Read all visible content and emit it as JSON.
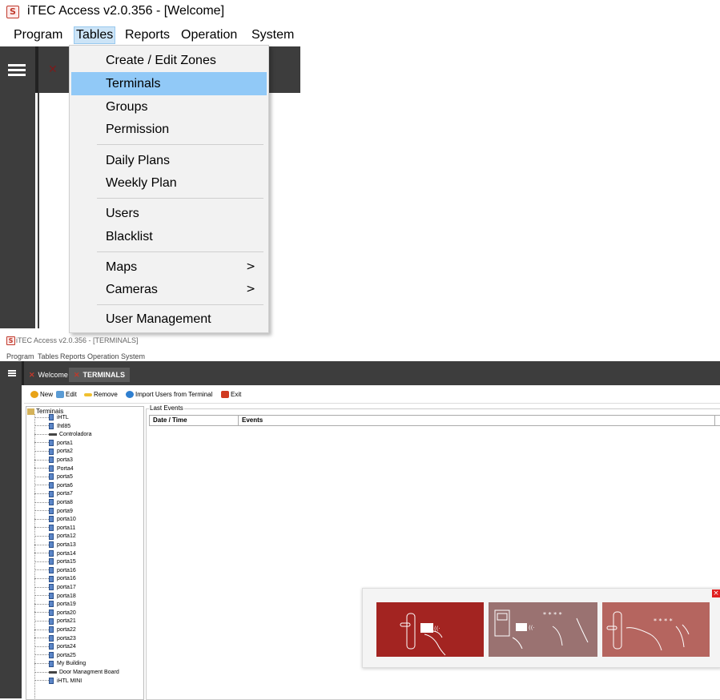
{
  "window1": {
    "logo": "S",
    "title": "iTEC Access v2.0.356 - [Welcome]",
    "menus": [
      "Program",
      "Tables",
      "Reports",
      "Operation",
      "System"
    ],
    "active_menu": "Tables",
    "dropdown": {
      "groups": [
        [
          {
            "label": "Create / Edit Zones"
          },
          {
            "label": "Terminals",
            "highlighted": true
          },
          {
            "label": "Groups"
          },
          {
            "label": "Permission"
          }
        ],
        [
          {
            "label": "Daily Plans"
          },
          {
            "label": "Weekly Plan"
          }
        ],
        [
          {
            "label": "Users"
          },
          {
            "label": "Blacklist"
          }
        ],
        [
          {
            "label": "Maps",
            "submenu": true
          },
          {
            "label": "Cameras",
            "submenu": true
          }
        ],
        [
          {
            "label": "User Management"
          }
        ]
      ],
      "submenu_arrow": ">"
    }
  },
  "window2": {
    "logo": "S",
    "title": "iTEC Access v2.0.356 - [TERMINALS]",
    "menus": [
      "Program",
      "Tables",
      "Reports",
      "Operation",
      "System"
    ],
    "tabs": [
      {
        "label": "Welcome",
        "active": false
      },
      {
        "label": "TERMINALS",
        "active": true
      }
    ],
    "toolbar": [
      {
        "label": "New",
        "icon": "new-icon",
        "color": "#e8a317"
      },
      {
        "label": "Edit",
        "icon": "edit-icon",
        "color": "#5a9bd4"
      },
      {
        "label": "Remove",
        "icon": "remove-icon",
        "color": "#f0c030"
      },
      {
        "label": "Import Users from Terminal",
        "icon": "import-icon",
        "color": "#2f7fd0"
      },
      {
        "label": "Exit",
        "icon": "exit-icon",
        "color": "#d03a20"
      }
    ],
    "tree": {
      "root": "Terminais",
      "items": [
        {
          "label": "iHTL",
          "type": "terminal"
        },
        {
          "label": "Ihtl85",
          "type": "terminal"
        },
        {
          "label": "Controladora",
          "type": "controller"
        },
        {
          "label": "porta1",
          "type": "terminal"
        },
        {
          "label": "porta2",
          "type": "terminal"
        },
        {
          "label": "porta3",
          "type": "terminal"
        },
        {
          "label": "Porta4",
          "type": "terminal"
        },
        {
          "label": "porta5",
          "type": "terminal"
        },
        {
          "label": "porta6",
          "type": "terminal"
        },
        {
          "label": "porta7",
          "type": "terminal"
        },
        {
          "label": "porta8",
          "type": "terminal"
        },
        {
          "label": "porta9",
          "type": "terminal"
        },
        {
          "label": "porta10",
          "type": "terminal"
        },
        {
          "label": "porta11",
          "type": "terminal"
        },
        {
          "label": "porta12",
          "type": "terminal"
        },
        {
          "label": "porta13",
          "type": "terminal"
        },
        {
          "label": "porta14",
          "type": "terminal"
        },
        {
          "label": "porta15",
          "type": "terminal"
        },
        {
          "label": "porta16",
          "type": "terminal"
        },
        {
          "label": "porta16",
          "type": "terminal"
        },
        {
          "label": "porta17",
          "type": "terminal"
        },
        {
          "label": "porta18",
          "type": "terminal"
        },
        {
          "label": "porta19",
          "type": "terminal"
        },
        {
          "label": "porta20",
          "type": "terminal"
        },
        {
          "label": "porta21",
          "type": "terminal"
        },
        {
          "label": "porta22",
          "type": "terminal"
        },
        {
          "label": "porta23",
          "type": "terminal"
        },
        {
          "label": "porta24",
          "type": "terminal"
        },
        {
          "label": "porta25",
          "type": "terminal"
        },
        {
          "label": "My Building",
          "type": "terminal"
        },
        {
          "label": "Door Managment Board",
          "type": "controller"
        },
        {
          "label": "iHTL MINI",
          "type": "terminal"
        }
      ]
    },
    "events": {
      "legend": "Last Events",
      "columns": [
        "Date / Time",
        "Events"
      ]
    }
  },
  "popup": {
    "close": "×",
    "colors": [
      "#a32421",
      "#9a7271",
      "#b5655f"
    ]
  }
}
